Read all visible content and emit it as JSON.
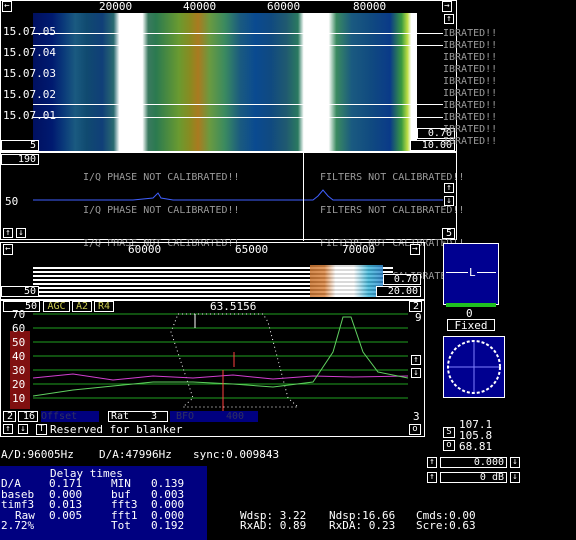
{
  "top_waterfall": {
    "freq_ticks": [
      "20000",
      "40000",
      "60000",
      "80000"
    ],
    "time_labels": [
      "15.07.05",
      "15.07.04",
      "15.07.03",
      "15.07.02",
      "15.07.01"
    ],
    "value_box_1": "0.70",
    "value_box_2": "10.00",
    "left_num": "5",
    "calib_msg": "IBRATED!!"
  },
  "wide_spectrum": {
    "left_num": "190",
    "level": "50",
    "right_num": "5",
    "iq_msg": "I/Q PHASE NOT CALIBRATED!!",
    "filters_msg": "FILTERS NOT CALIBRATED!!"
  },
  "mid_waterfall": {
    "freq_ticks": [
      "60000",
      "65000",
      "70000"
    ],
    "value_box_1": "0.70",
    "value_box_2": "20.00",
    "left_num": "50"
  },
  "baseband": {
    "left_num": "50",
    "agc": "AGC",
    "a2": "A2",
    "r4": "R4",
    "freq_readout": "63.5156",
    "right_num": "2",
    "y_ticks": [
      "70",
      "60",
      "50",
      "40",
      "30",
      "20",
      "10"
    ],
    "right_scale": "9",
    "bottom_left_1": "2",
    "bottom_left_2": "16",
    "offset_btn": "Offset",
    "rat_label": "Rat",
    "rat_value": "3",
    "bfo_btn": "BFO",
    "bfo_value": "400",
    "right_bottom_num": "3",
    "blanker_btn": "T",
    "blanker_text": "Reserved for blanker",
    "o_btn": "o"
  },
  "s_meter": {
    "marker": "L",
    "value": "0",
    "mode": "Fixed"
  },
  "signal_levels": {
    "s_btn": "S",
    "o_btn": "o",
    "v1": "107.1",
    "v2": "105.8",
    "v3": "68.81"
  },
  "gain_boxes": {
    "v1": "0.000",
    "v2": "0 dB"
  },
  "status": {
    "ad": "A/D:96005Hz",
    "da": "D/A:47996Hz",
    "sync": "sync:0.009843"
  },
  "delay_table": {
    "title": "Delay times",
    "rows": [
      {
        "a": "D/A",
        "b": "0.171",
        "c": "MIN",
        "d": "0.139"
      },
      {
        "a": "baseb",
        "b": "0.000",
        "c": "buf",
        "d": "0.003"
      },
      {
        "a": "timf3",
        "b": "0.013",
        "c": "fft3",
        "d": "0.000"
      },
      {
        "a": "Raw",
        "b": "0.005",
        "c": "fft1",
        "d": "0.000"
      },
      {
        "a": "2.72%",
        "b": "",
        "c": "Tot",
        "d": "0.192"
      }
    ]
  },
  "stats": {
    "wdsp": "Wdsp: 3.22",
    "ndsp": "Ndsp:16.66",
    "cmds": "Cmds:0.00",
    "rxad": "RxAD: 0.89",
    "rxda": "RxDA: 0.23",
    "scre": "Scre:0.63"
  }
}
